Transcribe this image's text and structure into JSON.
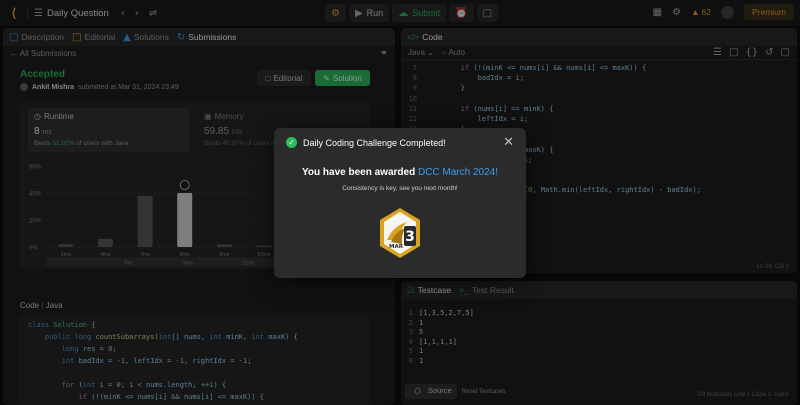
{
  "topbar": {
    "title": "Daily Question",
    "run_label": "Run",
    "submit_label": "Submit",
    "streak_count": "62",
    "premium_label": "Premium"
  },
  "left_tabs": [
    {
      "label": "Description",
      "active": false
    },
    {
      "label": "Editorial",
      "active": false
    },
    {
      "label": "Solutions",
      "active": false
    },
    {
      "label": "Submissions",
      "active": true
    }
  ],
  "submissions": {
    "back_label": "All Submissions",
    "status": "Accepted",
    "author": "Ankit Mishra",
    "submitted_text": "submitted at Mar 31, 2024 23:49",
    "editorial_label": "Editorial",
    "solution_label": "Solution",
    "runtime": {
      "label": "Runtime",
      "value": "8",
      "unit": "ms",
      "beats_prefix": "Beats",
      "beats_pct": "51.02%",
      "beats_suffix": "of users with Java"
    },
    "memory": {
      "label": "Memory",
      "value": "59.85",
      "unit": "MB",
      "beats_text": "Beats 40.97%",
      "beats_suffix": "of users with Java"
    }
  },
  "chart_data": {
    "type": "bar",
    "y_ticks": [
      "60%",
      "40%",
      "20%",
      "0%"
    ],
    "ylim": [
      0,
      60
    ],
    "categories": [
      "1ms",
      "4ms",
      "7ms",
      "8ms",
      "9ms",
      "10ms",
      "12ms",
      "15ms"
    ],
    "values": [
      2,
      6,
      38,
      40,
      2,
      1,
      1,
      1
    ],
    "highlight_index": 3,
    "mini_labels": [
      "7ms",
      "9ms",
      "12ms",
      "15ms"
    ]
  },
  "code_section": {
    "label": "Code",
    "language": "Java",
    "lines": [
      [
        {
          "t": "class ",
          "c": "kw"
        },
        {
          "t": "Solution",
          "c": "ty"
        },
        {
          "t": " {",
          "c": "tx"
        }
      ],
      [
        {
          "t": "    public long ",
          "c": "kw"
        },
        {
          "t": "countSubarrays",
          "c": "fn"
        },
        {
          "t": "(",
          "c": "tx"
        },
        {
          "t": "int",
          "c": "kw"
        },
        {
          "t": "[] nums, ",
          "c": "vr"
        },
        {
          "t": "int",
          "c": "kw"
        },
        {
          "t": " minK, ",
          "c": "vr"
        },
        {
          "t": "int",
          "c": "kw"
        },
        {
          "t": " maxK) {",
          "c": "vr"
        }
      ],
      [
        {
          "t": "        long",
          "c": "kw"
        },
        {
          "t": " res = ",
          "c": "vr"
        },
        {
          "t": "0",
          "c": "nm"
        },
        {
          "t": ";",
          "c": "tx"
        }
      ],
      [
        {
          "t": "        int",
          "c": "kw"
        },
        {
          "t": " badIdx = -",
          "c": "vr"
        },
        {
          "t": "1",
          "c": "nm"
        },
        {
          "t": ", leftIdx = -",
          "c": "vr"
        },
        {
          "t": "1",
          "c": "nm"
        },
        {
          "t": ", rightIdx = -",
          "c": "vr"
        },
        {
          "t": "1",
          "c": "nm"
        },
        {
          "t": ";",
          "c": "tx"
        }
      ],
      [
        {
          "t": "",
          "c": "tx"
        }
      ],
      [
        {
          "t": "        for",
          "c": "op"
        },
        {
          "t": " (",
          "c": "tx"
        },
        {
          "t": "int",
          "c": "kw"
        },
        {
          "t": " i = ",
          "c": "vr"
        },
        {
          "t": "0",
          "c": "nm"
        },
        {
          "t": "; i < nums.length; ++i) {",
          "c": "vr"
        }
      ],
      [
        {
          "t": "            if",
          "c": "op"
        },
        {
          "t": " (!(minK <= nums[i] && nums[i] <= maxK)) {",
          "c": "vr"
        }
      ],
      [
        {
          "t": "                badIdx = i;",
          "c": "vr"
        }
      ]
    ]
  },
  "editor": {
    "tab_label": "Code",
    "language": "Java",
    "auto_label": "Auto",
    "status": "Ln 24, Col 2",
    "lines": [
      {
        "n": "7",
        "s": [
          {
            "t": "        if",
            "c": "op"
          },
          {
            "t": " (!(minK <= nums[i] && nums[i] <= maxK)) {",
            "c": "vr"
          }
        ]
      },
      {
        "n": "8",
        "s": [
          {
            "t": "            badIdx = i;",
            "c": "vr"
          }
        ]
      },
      {
        "n": "9",
        "s": [
          {
            "t": "        }",
            "c": "tx"
          }
        ]
      },
      {
        "n": "10",
        "s": [
          {
            "t": "",
            "c": "tx"
          }
        ]
      },
      {
        "n": "11",
        "s": [
          {
            "t": "        if",
            "c": "op"
          },
          {
            "t": " (nums[i] == minK) {",
            "c": "vr"
          }
        ]
      },
      {
        "n": "12",
        "s": [
          {
            "t": "            leftIdx = i;",
            "c": "vr"
          }
        ]
      },
      {
        "n": "13",
        "s": [
          {
            "t": "        }",
            "c": "tx"
          }
        ]
      },
      {
        "n": "14",
        "s": [
          {
            "t": "",
            "c": "tx"
          }
        ]
      },
      {
        "n": "15",
        "s": [
          {
            "t": "        if",
            "c": "op"
          },
          {
            "t": " (nums[i] == maxK) {",
            "c": "vr"
          }
        ]
      },
      {
        "n": "16",
        "s": [
          {
            "t": "            rightIdx = i;",
            "c": "vr"
          }
        ]
      },
      {
        "n": "17",
        "s": [
          {
            "t": "        }",
            "c": "tx"
          }
        ]
      },
      {
        "n": "18",
        "s": [
          {
            "t": "",
            "c": "tx"
          }
        ]
      },
      {
        "n": "19",
        "s": [
          {
            "t": "        res += Math.max(",
            "c": "vr"
          },
          {
            "t": "0",
            "c": "nm"
          },
          {
            "t": ", Math.min(leftIdx, rightIdx) - badIdx);",
            "c": "vr"
          }
        ]
      },
      {
        "n": "20",
        "s": [
          {
            "t": "        }",
            "c": "tx"
          }
        ]
      },
      {
        "n": "21",
        "s": [
          {
            "t": "",
            "c": "tx"
          }
        ]
      },
      {
        "n": "22",
        "s": [
          {
            "t": "        return",
            "c": "op"
          },
          {
            "t": " res;",
            "c": "vr"
          }
        ]
      },
      {
        "n": "23",
        "s": [
          {
            "t": "    }",
            "c": "tx"
          }
        ]
      },
      {
        "n": "24",
        "s": [
          {
            "t": "}",
            "c": "tx"
          }
        ]
      }
    ]
  },
  "testcase": {
    "tab_label": "Testcase",
    "result_label": "Test Result",
    "lines": [
      {
        "n": "1",
        "t": "[1,3,5,2,7,5]"
      },
      {
        "n": "2",
        "t": "1"
      },
      {
        "n": "3",
        "t": "5"
      },
      {
        "n": "4",
        "t": "[1,1,1,1]"
      },
      {
        "n": "5",
        "t": "1"
      },
      {
        "n": "6",
        "t": "1"
      }
    ],
    "source_label": "Source",
    "reset_label": "Reset Testcases",
    "status_right": "2/8 testcases   Line 1   Case 1: nums"
  },
  "modal": {
    "heading": "Daily Coding Challenge Completed!",
    "title_prefix": "You have been awarded",
    "title_highlight": "DCC March 2024!",
    "subtitle": "Consistency is key, see you next month!",
    "badge_number": "3",
    "badge_month": "MAR"
  },
  "colors": {
    "accent_green": "#2cbb5d",
    "accent_orange": "#f0a033",
    "link_blue": "#3b9cf0"
  }
}
